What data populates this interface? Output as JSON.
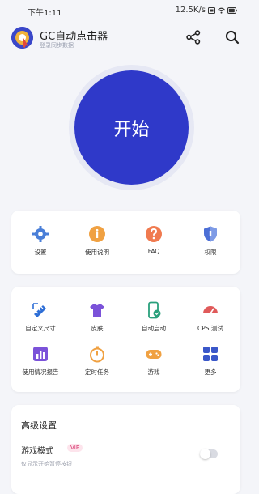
{
  "status_bar": {
    "time": "下午1:11",
    "network": "12.5K/s"
  },
  "header": {
    "title": "GC自动点击器",
    "subtitle": "登录同步数据"
  },
  "start_button": {
    "label": "开始"
  },
  "quick_menu": [
    {
      "label": "设置",
      "icon": "gear-icon",
      "color": "#4a7fd8"
    },
    {
      "label": "使用说明",
      "icon": "info-icon",
      "color": "#f0a142"
    },
    {
      "label": "FAQ",
      "icon": "question-icon",
      "color": "#f07a4f"
    },
    {
      "label": "权限",
      "icon": "shield-icon",
      "color": "#4c6fd6"
    }
  ],
  "tools": [
    {
      "label": "自定义尺寸",
      "icon": "ruler-icon",
      "color": "#2e6ed6"
    },
    {
      "label": "皮肤",
      "icon": "shirt-icon",
      "color": "#7b52d9"
    },
    {
      "label": "自动启动",
      "icon": "phone-icon",
      "color": "#2aa07c"
    },
    {
      "label": "CPS 测试",
      "icon": "speedometer-icon",
      "color": "#e05a5a"
    },
    {
      "label": "使用情况报告",
      "icon": "chart-icon",
      "color": "#7b52d9"
    },
    {
      "label": "定时任务",
      "icon": "timer-icon",
      "color": "#f0a142"
    },
    {
      "label": "游戏",
      "icon": "gamepad-icon",
      "color": "#f0a142"
    },
    {
      "label": "更多",
      "icon": "grid-icon",
      "color": "#3a57c9"
    }
  ],
  "advanced": {
    "title": "高级设置",
    "game_mode": {
      "label": "游戏模式",
      "badge": "VIP",
      "description": "仅显示开始暂停按钮",
      "enabled": false
    }
  }
}
